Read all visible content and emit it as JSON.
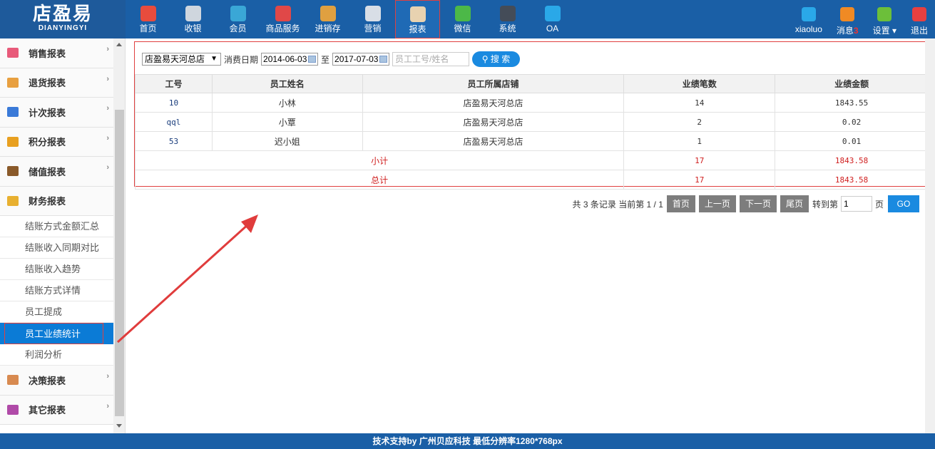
{
  "logo": {
    "cn": "店盈易",
    "en": "DIANYINGYI"
  },
  "nav": [
    {
      "label": "首页",
      "icon": "home-icon",
      "color": "#e84c3d"
    },
    {
      "label": "收银",
      "icon": "cash-register-icon",
      "color": "#cfd6de"
    },
    {
      "label": "会员",
      "icon": "member-icon",
      "color": "#3aa7d6"
    },
    {
      "label": "商品服务",
      "icon": "goods-icon",
      "color": "#e04848"
    },
    {
      "label": "进销存",
      "icon": "inventory-icon",
      "color": "#e0a040"
    },
    {
      "label": "营销",
      "icon": "megaphone-icon",
      "color": "#d8dee6"
    },
    {
      "label": "报表",
      "icon": "report-icon",
      "color": "#e8d2b0"
    },
    {
      "label": "微信",
      "icon": "wechat-icon",
      "color": "#4cb848"
    },
    {
      "label": "系统",
      "icon": "monitor-icon",
      "color": "#444c58"
    },
    {
      "label": "OA",
      "icon": "oa-icon",
      "color": "#2aa8e8"
    }
  ],
  "right_nav": {
    "user": "xiaoluo",
    "messages_label": "消息",
    "messages_count": "3",
    "settings_label": "设置",
    "logout_label": "退出"
  },
  "sidebar": {
    "groups_top": [
      {
        "label": "销售报表",
        "icon": "sales-report-icon",
        "color": "#e85a7a"
      },
      {
        "label": "退货报表",
        "icon": "return-report-icon",
        "color": "#e8a040"
      },
      {
        "label": "计次报表",
        "icon": "count-report-icon",
        "color": "#3a7ad8"
      },
      {
        "label": "积分报表",
        "icon": "points-report-icon",
        "color": "#e8a020"
      },
      {
        "label": "储值报表",
        "icon": "stored-value-icon",
        "color": "#8a5a2a"
      },
      {
        "label": "财务报表",
        "icon": "finance-report-icon",
        "color": "#e8b030"
      }
    ],
    "sub_items": [
      "结账方式金额汇总",
      "结账收入同期对比",
      "结账收入趋势",
      "结账方式详情",
      "员工提成",
      "员工业绩统计",
      "利润分析"
    ],
    "groups_bottom": [
      {
        "label": "决策报表",
        "icon": "decision-report-icon",
        "color": "#d88a50"
      },
      {
        "label": "其它报表",
        "icon": "other-report-icon",
        "color": "#b04aa8"
      }
    ]
  },
  "filter": {
    "store": "店盈易天河总店",
    "date_label": "消费日期",
    "date_from": "2014-06-03",
    "to_label": "至",
    "date_to": "2017-07-03",
    "search_placeholder": "员工工号/姓名",
    "search_btn": "搜 索"
  },
  "table": {
    "headers": [
      "工号",
      "员工姓名",
      "员工所属店铺",
      "业绩笔数",
      "业绩金额"
    ],
    "rows": [
      {
        "id": "10",
        "name": "小林",
        "store": "店盈易天河总店",
        "count": "14",
        "amount": "1843.55"
      },
      {
        "id": "qql",
        "name": "小覃",
        "store": "店盈易天河总店",
        "count": "2",
        "amount": "0.02"
      },
      {
        "id": "53",
        "name": "迟小姐",
        "store": "店盈易天河总店",
        "count": "1",
        "amount": "0.01"
      }
    ],
    "subtotal": {
      "label": "小计",
      "count": "17",
      "amount": "1843.58"
    },
    "total": {
      "label": "总计",
      "count": "17",
      "amount": "1843.58"
    }
  },
  "pager": {
    "summary": "共 3 条记录 当前第 1 / 1",
    "first": "首页",
    "prev": "上一页",
    "next": "下一页",
    "last": "尾页",
    "goto_label": "转到第",
    "goto_value": "1",
    "page_suffix": "页",
    "go": "GO"
  },
  "footer": "技术支持by 广州贝应科技    最低分辨率1280*768px"
}
